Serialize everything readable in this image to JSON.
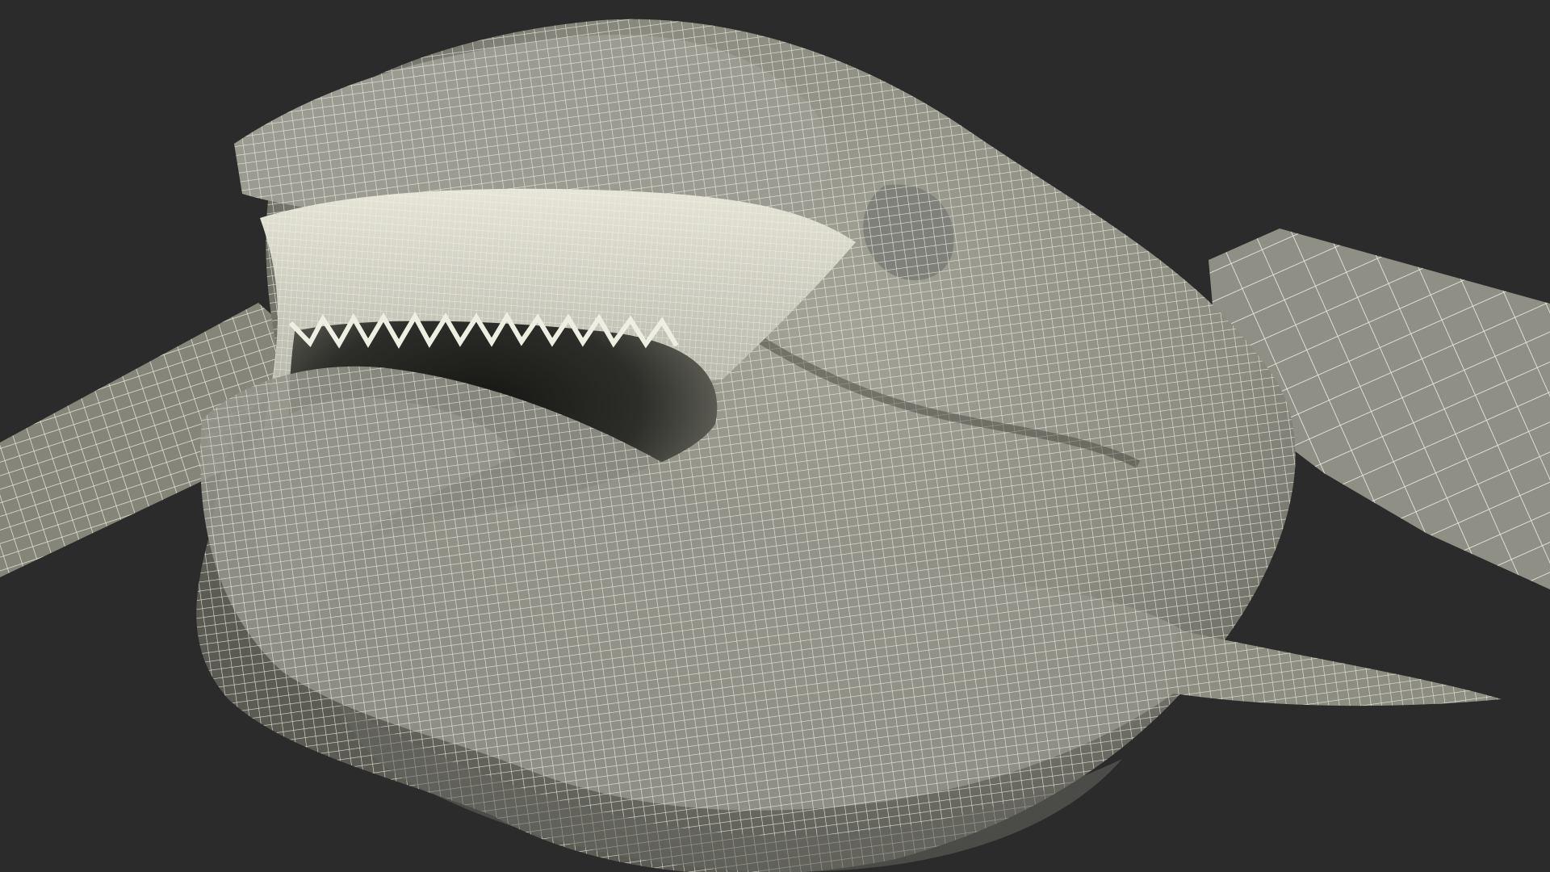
{
  "scene": {
    "background_color": "#2b2b2b",
    "mesh_fill_color": "#8f8f84",
    "mesh_shadow_color": "#4e4e47",
    "mesh_dark_color": "#1b1b19",
    "wire_color": "#f1f0e4",
    "subject_icon": "wireframe-turtle-head-model-icon"
  }
}
